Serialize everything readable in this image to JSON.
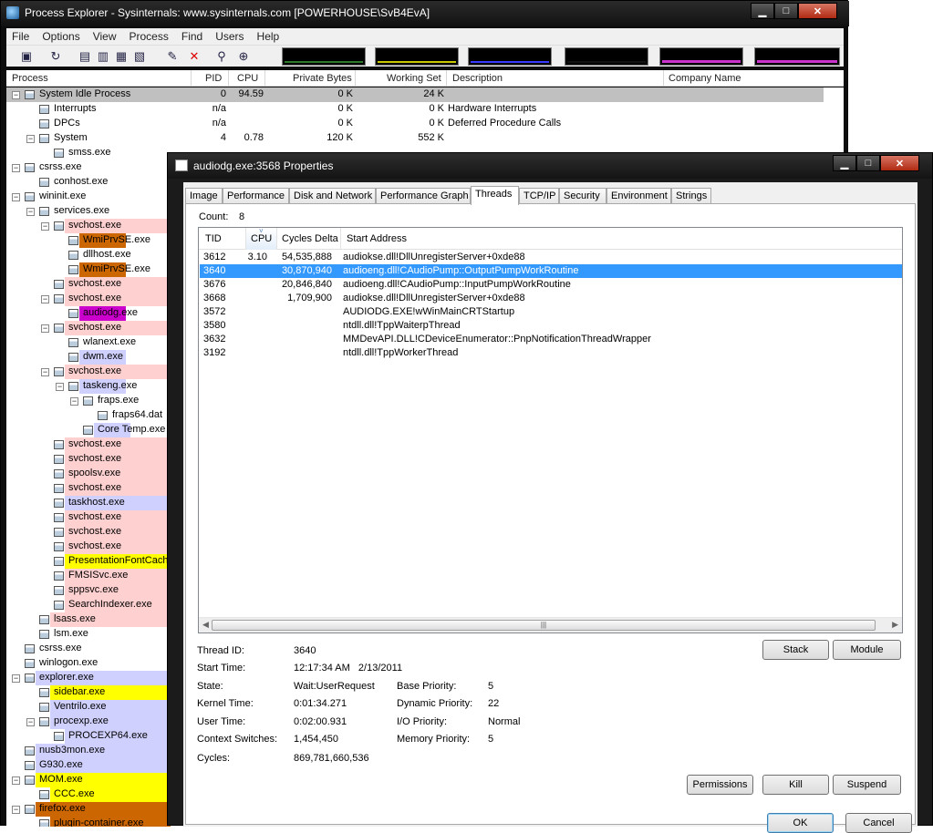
{
  "main_window": {
    "title": "Process Explorer - Sysinternals: www.sysinternals.com [POWERHOUSE\\SvB4EvA]",
    "menu": [
      "File",
      "Options",
      "View",
      "Process",
      "Find",
      "Users",
      "Help"
    ],
    "columns": {
      "process": "Process",
      "pid": "PID",
      "cpu": "CPU",
      "private_bytes": "Private Bytes",
      "working_set": "Working Set",
      "description": "Description",
      "company": "Company Name"
    },
    "processes": [
      {
        "name": "System Idle Process",
        "pid": "0",
        "cpu": "94.59",
        "pb": "0 K",
        "ws": "24 K",
        "desc": ""
      },
      {
        "name": "Interrupts",
        "pid": "n/a",
        "cpu": "",
        "pb": "0 K",
        "ws": "0 K",
        "desc": "Hardware Interrupts"
      },
      {
        "name": "DPCs",
        "pid": "n/a",
        "cpu": "",
        "pb": "0 K",
        "ws": "0 K",
        "desc": "Deferred Procedure Calls"
      },
      {
        "name": "System",
        "pid": "4",
        "cpu": "0.78",
        "pb": "120 K",
        "ws": "552 K",
        "desc": ""
      },
      {
        "name": "smss.exe",
        "pid": "",
        "cpu": "",
        "pb": "",
        "ws": "",
        "desc": ""
      },
      {
        "name": "csrss.exe"
      },
      {
        "name": "conhost.exe"
      },
      {
        "name": "wininit.exe"
      },
      {
        "name": "services.exe"
      },
      {
        "name": "svchost.exe"
      },
      {
        "name": "WmiPrvSE.exe"
      },
      {
        "name": "dllhost.exe"
      },
      {
        "name": "WmiPrvSE.exe"
      },
      {
        "name": "svchost.exe"
      },
      {
        "name": "svchost.exe"
      },
      {
        "name": "audiodg.exe"
      },
      {
        "name": "svchost.exe"
      },
      {
        "name": "wlanext.exe"
      },
      {
        "name": "dwm.exe"
      },
      {
        "name": "svchost.exe"
      },
      {
        "name": "taskeng.exe"
      },
      {
        "name": "fraps.exe"
      },
      {
        "name": "fraps64.dat"
      },
      {
        "name": "Core Temp.exe"
      },
      {
        "name": "svchost.exe"
      },
      {
        "name": "svchost.exe"
      },
      {
        "name": "spoolsv.exe"
      },
      {
        "name": "svchost.exe"
      },
      {
        "name": "taskhost.exe"
      },
      {
        "name": "svchost.exe"
      },
      {
        "name": "svchost.exe"
      },
      {
        "name": "svchost.exe"
      },
      {
        "name": "PresentationFontCache"
      },
      {
        "name": "FMSISvc.exe"
      },
      {
        "name": "sppsvc.exe"
      },
      {
        "name": "SearchIndexer.exe"
      },
      {
        "name": "lsass.exe"
      },
      {
        "name": "lsm.exe"
      },
      {
        "name": "csrss.exe"
      },
      {
        "name": "winlogon.exe"
      },
      {
        "name": "explorer.exe"
      },
      {
        "name": "sidebar.exe"
      },
      {
        "name": "Ventrilo.exe"
      },
      {
        "name": "procexp.exe"
      },
      {
        "name": "PROCEXP64.exe"
      },
      {
        "name": "nusb3mon.exe"
      },
      {
        "name": "G930.exe"
      },
      {
        "name": "MOM.exe"
      },
      {
        "name": "CCC.exe"
      },
      {
        "name": "firefox.exe"
      },
      {
        "name": "plugin-container.exe"
      }
    ]
  },
  "dialog": {
    "title": "audiodg.exe:3568 Properties",
    "tabs": [
      "Image",
      "Performance",
      "Disk and Network",
      "Performance Graph",
      "Threads",
      "TCP/IP",
      "Security",
      "Environment",
      "Strings"
    ],
    "active_tab": "Threads",
    "count_label": "Count:",
    "count_value": "8",
    "thread_columns": {
      "tid": "TID",
      "cpu": "CPU",
      "cycles": "Cycles Delta",
      "start": "Start Address"
    },
    "threads": [
      {
        "tid": "3612",
        "cpu": "3.10",
        "cycles": "54,535,888",
        "start": "audiokse.dll!DllUnregisterServer+0xde88"
      },
      {
        "tid": "3640",
        "cpu": "",
        "cycles": "30,870,940",
        "start": "audioeng.dll!CAudioPump::OutputPumpWorkRoutine"
      },
      {
        "tid": "3676",
        "cpu": "",
        "cycles": "20,846,840",
        "start": "audioeng.dll!CAudioPump::InputPumpWorkRoutine"
      },
      {
        "tid": "3668",
        "cpu": "",
        "cycles": "1,709,900",
        "start": "audiokse.dll!DllUnregisterServer+0xde88"
      },
      {
        "tid": "3572",
        "cpu": "",
        "cycles": "",
        "start": "AUDIODG.EXE!wWinMainCRTStartup"
      },
      {
        "tid": "3580",
        "cpu": "",
        "cycles": "",
        "start": "ntdll.dll!TppWaiterpThread"
      },
      {
        "tid": "3632",
        "cpu": "",
        "cycles": "",
        "start": "MMDevAPI.DLL!CDeviceEnumerator::PnpNotificationThreadWrapper"
      },
      {
        "tid": "3192",
        "cpu": "",
        "cycles": "",
        "start": "ntdll.dll!TppWorkerThread"
      }
    ],
    "selected_thread": "3640",
    "details": {
      "thread_id_label": "Thread ID:",
      "thread_id": "3640",
      "start_time_label": "Start Time:",
      "start_time": "12:17:34 AM   2/13/2011",
      "state_label": "State:",
      "state": "Wait:UserRequest",
      "base_priority_label": "Base Priority:",
      "base_priority": "5",
      "kernel_time_label": "Kernel Time:",
      "kernel_time": "0:01:34.271",
      "dynamic_priority_label": "Dynamic Priority:",
      "dynamic_priority": "22",
      "user_time_label": "User Time:",
      "user_time": "0:02:00.931",
      "io_priority_label": "I/O Priority:",
      "io_priority": "Normal",
      "context_switches_label": "Context Switches:",
      "context_switches": "1,454,450",
      "memory_priority_label": "Memory Priority:",
      "memory_priority": "5",
      "cycles_label": "Cycles:",
      "cycles": "869,781,660,536"
    },
    "buttons": {
      "stack": "Stack",
      "module": "Module",
      "permissions": "Permissions",
      "kill": "Kill",
      "suspend": "Suspend",
      "ok": "OK",
      "cancel": "Cancel"
    }
  },
  "colors": {
    "service_pink": "#ffd0d0",
    "own_process_blue": "#d0d0ff",
    "dotnet_yellow": "#ffff00",
    "packed_purple": "#cc00cc",
    "new_brown": "#cc6600",
    "selected_gray": "#c0c0c0",
    "selection_blue": "#3399ff"
  }
}
